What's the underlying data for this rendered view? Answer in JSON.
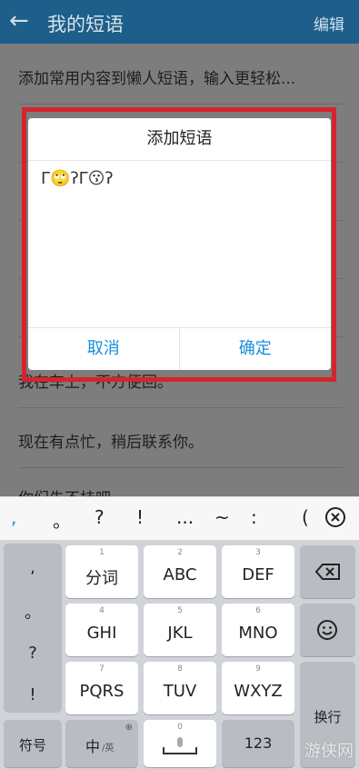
{
  "appbar": {
    "back_icon": "←",
    "title": "我的短语",
    "edit_label": "编辑"
  },
  "list": {
    "items": [
      "添加常用内容到懒人短语，输入更轻松...",
      "我在车上，不方便回。",
      "现在有点忙，稍后联系你。",
      "你们先不挂吧"
    ]
  },
  "dialog": {
    "title": "添加短语",
    "text": "ᒥ🙄ʔᒥ😗ʔ",
    "cancel_label": "取消",
    "ok_label": "确定"
  },
  "keyboard": {
    "symbols": [
      ",",
      "。",
      "?",
      "!",
      "...",
      "~",
      ":",
      "("
    ],
    "punc_column": [
      ",",
      "。",
      "?",
      "!"
    ],
    "rows": [
      [
        {
          "num": "1",
          "label": "分词"
        },
        {
          "num": "2",
          "label": "ABC"
        },
        {
          "num": "3",
          "label": "DEF"
        }
      ],
      [
        {
          "num": "4",
          "label": "GHI"
        },
        {
          "num": "5",
          "label": "JKL"
        },
        {
          "num": "6",
          "label": "MNO"
        }
      ],
      [
        {
          "num": "7",
          "label": "PQRS"
        },
        {
          "num": "8",
          "label": "TUV"
        },
        {
          "num": "9",
          "label": "WXYZ"
        }
      ]
    ],
    "bottom": {
      "symbol": "符号",
      "lang": "中",
      "lang_sub": "/英",
      "zero": "0",
      "num": "123",
      "enter": "换行"
    },
    "watermark": "游侠网",
    "colors": {
      "accent": "#1d8fd5",
      "appbar": "#1d5f8a",
      "highlight": "#d6242c"
    }
  }
}
